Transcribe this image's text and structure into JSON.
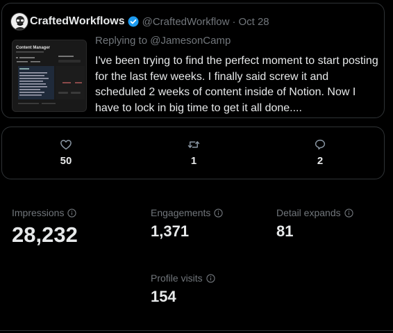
{
  "tweet": {
    "display_name": "CraftedWorkflows",
    "handle": "@CraftedWorkflow",
    "separator": "·",
    "date": "Oct 28",
    "replying_prefix": "Replying to ",
    "replying_to": "@JamesonCamp",
    "text": "I've been trying to find the perfect moment to start posting for the last few weeks.  I finally said screw it and scheduled 2 weeks of content inside of Notion.  Now I have to lock in big time to get it all done....",
    "thumbnail_title": "Content Manager",
    "verified_color": "#1d9bf0"
  },
  "actions": {
    "likes": "50",
    "retweets": "1",
    "replies": "2"
  },
  "metrics": {
    "impressions_label": "Impressions",
    "impressions_value": "28,232",
    "engagements_label": "Engagements",
    "engagements_value": "1,371",
    "detail_expands_label": "Detail expands",
    "detail_expands_value": "81",
    "profile_visits_label": "Profile visits",
    "profile_visits_value": "154"
  },
  "colors": {
    "background": "#000000",
    "text": "#e7e9ea",
    "muted": "#71767b",
    "border": "#2f3336",
    "accent": "#1d9bf0"
  }
}
